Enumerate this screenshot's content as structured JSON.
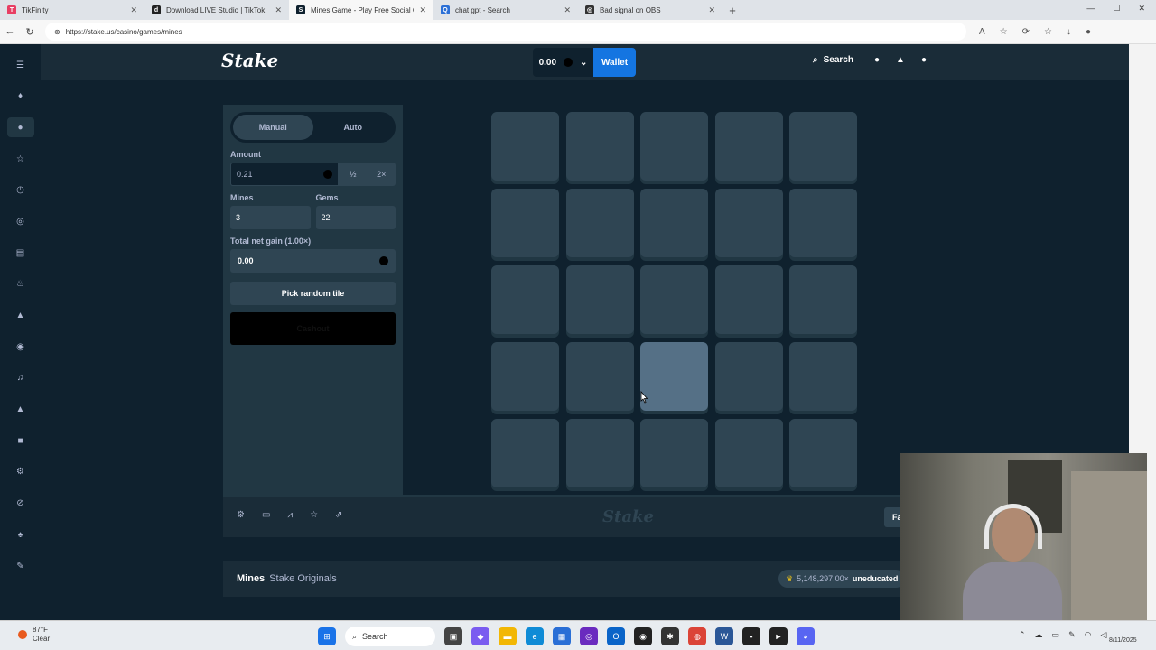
{
  "browser": {
    "tabs": [
      {
        "label": "TikFinity",
        "color": "#e83e63",
        "glyph": "T"
      },
      {
        "label": "Download LIVE Studio | TikTok",
        "color": "#222222",
        "glyph": "d"
      },
      {
        "label": "Mines Game - Play Free Social Ca",
        "color": "#0f212e",
        "glyph": "S"
      },
      {
        "label": "chat gpt - Search",
        "color": "#2a6fd6",
        "glyph": "Q"
      },
      {
        "label": "Bad signal on OBS",
        "color": "#333333",
        "glyph": "◎"
      }
    ],
    "url": "https://stake.us/casino/games/mines"
  },
  "topbar": {
    "logo": "Stake",
    "balance": "0.00",
    "wallet_label": "Wallet",
    "search_label": "Search"
  },
  "controls": {
    "mode_manual": "Manual",
    "mode_auto": "Auto",
    "amount_label": "Amount",
    "amount_value": "0.21",
    "half_label": "½",
    "double_label": "2×",
    "mines_label": "Mines",
    "mines_value": "3",
    "gems_label": "Gems",
    "gems_value": "22",
    "gain_label": "Total net gain (1.00×)",
    "gain_value": "0.00",
    "random_label": "Pick random tile",
    "cashout_label": "Cashout"
  },
  "grid": {
    "rows": 5,
    "cols": 5,
    "hover_index": 17
  },
  "footer": {
    "logo": "Stake",
    "fairness_label": "Fairness"
  },
  "info_bar": {
    "title": "Mines",
    "subtitle": "Stake Originals",
    "top_win": "5,148,297.00×",
    "top_user": "uneducated"
  },
  "taskbar": {
    "temp": "87°F",
    "weather": "Clear",
    "search": "Search",
    "date": "8/11/2025"
  },
  "colors": {
    "bg": "#0f212e",
    "panel": "#213743",
    "tile": "#2f4553",
    "tile_hover": "#557086",
    "wallet": "#1475e1"
  }
}
